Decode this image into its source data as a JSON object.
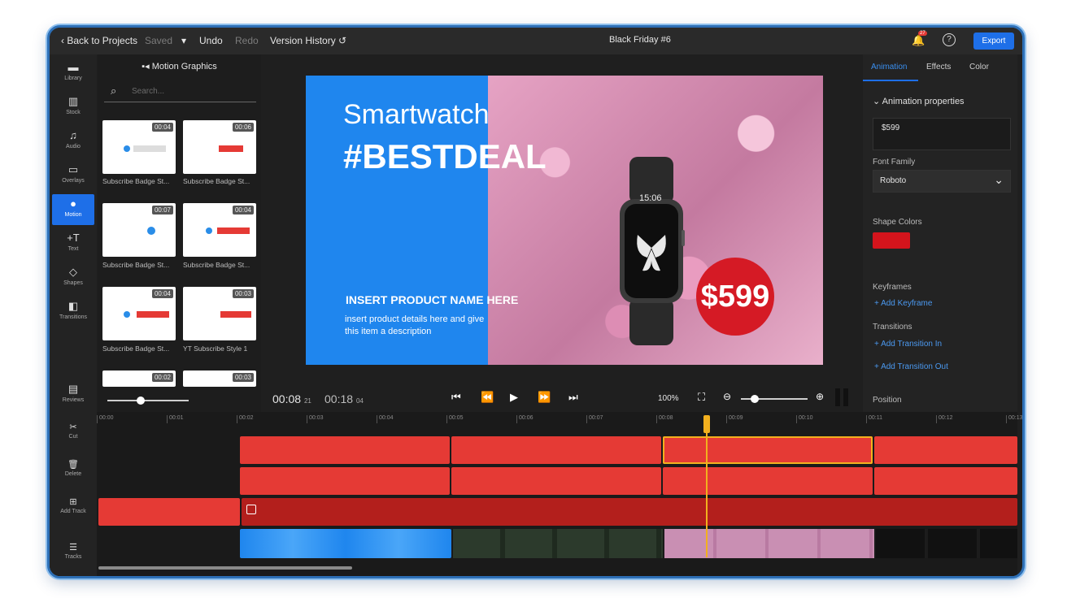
{
  "topbar": {
    "back": "Back to Projects",
    "saved": "Saved",
    "undo": "Undo",
    "redo": "Redo",
    "version_history": "Version History",
    "project_title": "Black Friday #6",
    "notification_count": "27",
    "export": "Export"
  },
  "rail": [
    {
      "label": "Library",
      "icon": "folder-icon"
    },
    {
      "label": "Stock",
      "icon": "stock-icon"
    },
    {
      "label": "Audio",
      "icon": "music-icon"
    },
    {
      "label": "Overlays",
      "icon": "overlay-icon"
    },
    {
      "label": "Motion",
      "icon": "motion-icon"
    },
    {
      "label": "Text",
      "icon": "text-icon"
    },
    {
      "label": "Shapes",
      "icon": "shapes-icon"
    },
    {
      "label": "Transitions",
      "icon": "transitions-icon"
    },
    {
      "label": "Reviews",
      "icon": "reviews-icon"
    }
  ],
  "library": {
    "title": "Motion Graphics",
    "search_placeholder": "Search...",
    "items": [
      {
        "duration": "00:04",
        "label": "Subscribe Badge St..."
      },
      {
        "duration": "00:06",
        "label": "Subscribe Badge St..."
      },
      {
        "duration": "00:07",
        "label": "Subscribe Badge St..."
      },
      {
        "duration": "00:04",
        "label": "Subscribe Badge St..."
      },
      {
        "duration": "00:04",
        "label": "Subscribe Badge St..."
      },
      {
        "duration": "00:03",
        "label": "YT Subscribe Style 1"
      },
      {
        "duration": "00:02",
        "label": ""
      },
      {
        "duration": "00:03",
        "label": ""
      }
    ]
  },
  "canvas": {
    "headline": "Smartwatch",
    "hashtag": "#BESTDEAL",
    "product_name": "INSERT PRODUCT NAME HERE",
    "product_details_1": "insert product details here and give",
    "product_details_2": "this item a description",
    "watch_time": "15:06",
    "price": "$599",
    "colors": {
      "left_panel": "#1f86ee",
      "price_badge": "#d51a25"
    }
  },
  "playback": {
    "current_time": "00:08",
    "current_frame": "21",
    "total_time": "00:18",
    "total_frame": "04",
    "zoom": "100%"
  },
  "properties": {
    "tabs": [
      "Animation",
      "Effects",
      "Color"
    ],
    "section_title": "Animation properties",
    "text_value": "$599",
    "font_family_label": "Font Family",
    "font_family_value": "Roboto",
    "shape_colors_label": "Shape Colors",
    "shape_color": "#d4141c",
    "keyframes_label": "Keyframes",
    "add_keyframe": "+ Add Keyframe",
    "transitions_label": "Transitions",
    "add_transition_in": "+ Add Transition In",
    "add_transition_out": "+ Add Transition Out",
    "position_label": "Position"
  },
  "timeline": {
    "tools": [
      "Cut",
      "Delete",
      "Add Track",
      "Tracks"
    ],
    "ticks": [
      "00:00",
      "00:01",
      "00:02",
      "00:03",
      "00:04",
      "00:05",
      "00:06",
      "00:07",
      "00:08",
      "00:09",
      "00:10",
      "00:11",
      "00:12",
      "00:13"
    ]
  }
}
